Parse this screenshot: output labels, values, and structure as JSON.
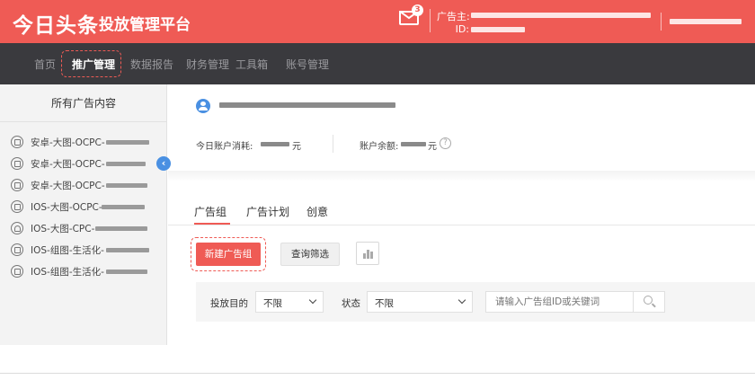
{
  "header": {
    "logo": "今日头条",
    "platform_name": "投放管理平台",
    "mail_badge": "3",
    "advertiser_label": "广告主:",
    "advertiser_id_label": "ID:",
    "brand_color": "#ef5b55"
  },
  "nav": {
    "items": [
      "首页",
      "推广管理",
      "数据报告",
      "财务管理",
      "工具箱",
      "账号管理"
    ],
    "active": "推广管理"
  },
  "sidebar": {
    "title": "所有广告内容",
    "items": [
      {
        "label": "安卓-大图-OCPC-",
        "icon": "ad-icon"
      },
      {
        "label": "安卓-大图-OCPC-",
        "icon": "ad-icon"
      },
      {
        "label": "安卓-大图-OCPC-",
        "icon": "ad-icon"
      },
      {
        "label": "IOS-大图-OCPC-",
        "icon": "ad-icon"
      },
      {
        "label": "IOS-大图-CPC-",
        "icon": "lock-icon"
      },
      {
        "label": "IOS-组图-生活化-",
        "icon": "ad-icon"
      },
      {
        "label": "IOS-组图-生活化-",
        "icon": "ad-icon"
      }
    ],
    "collapse_glyph": "‹"
  },
  "account": {
    "today_spend_label": "今日账户消耗:",
    "today_spend_unit": "元",
    "balance_label": "账户余额:",
    "balance_unit": "元",
    "help_glyph": "?"
  },
  "tabs": [
    {
      "label": "广告组",
      "active": true
    },
    {
      "label": "广告计划",
      "active": false
    },
    {
      "label": "创意",
      "active": false
    }
  ],
  "actions": {
    "new_group": "新建广告组",
    "query_filter": "查询筛选"
  },
  "filters": {
    "purpose_label": "投放目的",
    "purpose_value": "不限",
    "status_label": "状态",
    "status_value": "不限",
    "search_placeholder": "请输入广告组ID或关键词"
  }
}
